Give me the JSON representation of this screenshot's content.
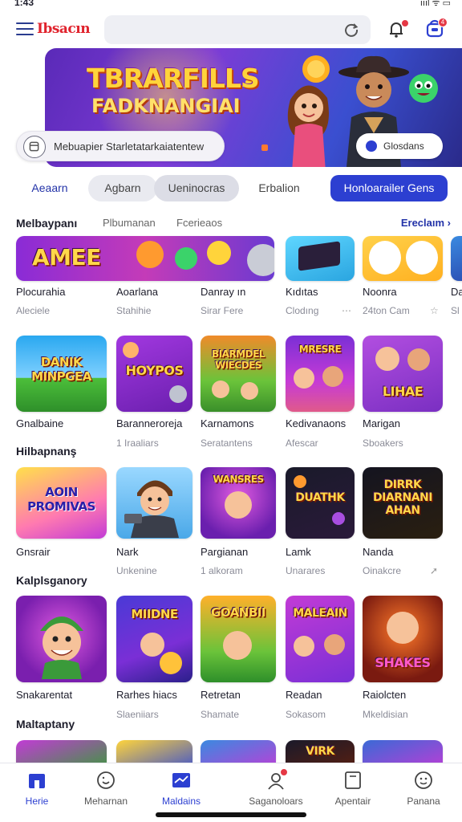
{
  "status": {
    "time": "1:43",
    "right": "ıııl ᯤ ▭"
  },
  "header": {
    "logo": "Ibsacın",
    "search_placeholder": "",
    "notif_badge": "",
    "cart_badge": "4"
  },
  "banner": {
    "title_line1": "TBRARFILLS",
    "title_line2": "FADKNANGIAI",
    "input_text": "Mebuapier Starletatarkaiatentew",
    "button_label": "Glosdans"
  },
  "tabs": [
    "Aeaarn",
    "Agbarn",
    "Ueninocras",
    "Erbalion",
    "Honloarailer Gens"
  ],
  "section1": {
    "title": "Melbaypanı",
    "subtabs": [
      "Plbumanan",
      "Fcerieaos"
    ],
    "see_all": "Ereclaım ›"
  },
  "row1": [
    {
      "name": "Plocurahia",
      "sub": "Aleciele",
      "art": "AMEE"
    },
    {
      "name": "Aoarlana",
      "sub": "Stahihie",
      "art": ""
    },
    {
      "name": "Danray ın",
      "sub": "Sirar Fere",
      "art": ""
    },
    {
      "name": "Kıdıtas",
      "sub": "Clodıng",
      "art": ""
    },
    {
      "name": "Noonra",
      "sub": "24ton Cam",
      "art": ""
    },
    {
      "name": "Da",
      "sub": "Sl",
      "art": ""
    }
  ],
  "row2": [
    {
      "name": "Gnalbaine",
      "sub": "",
      "art": "DANIK MINPGEA"
    },
    {
      "name": "Baranneroreja",
      "sub": "1 Iraaliars",
      "art": "HOYPOS"
    },
    {
      "name": "Karnamons",
      "sub": "Seratantens",
      "art": "BIARMDEL WIECDES"
    },
    {
      "name": "Kedivanaons",
      "sub": "Afescar",
      "art": "MRESRE"
    },
    {
      "name": "Marigan",
      "sub": "Sboakers",
      "art": "LIHAE"
    }
  ],
  "section2": {
    "title": "Hilbapnanş"
  },
  "row3": [
    {
      "name": "Gnsrair",
      "sub": "",
      "art": "AOIN PROMIVAS"
    },
    {
      "name": "Nark",
      "sub": "Unkenine",
      "art": ""
    },
    {
      "name": "Pargianan",
      "sub": "1 alkoram",
      "art": "WANSRES"
    },
    {
      "name": "Lamk",
      "sub": "Unarares",
      "art": "DUATHK"
    },
    {
      "name": "Nanda",
      "sub": "Oinakcre",
      "art": "DIRRK DIARNANI AHAN"
    }
  ],
  "section3": {
    "title": "Kalplsganory"
  },
  "row4": [
    {
      "name": "Snakarentat",
      "sub": "",
      "art": ""
    },
    {
      "name": "Rarhes hiacs",
      "sub": "Slaeniiars",
      "art": "MIIDNE"
    },
    {
      "name": "Retretan",
      "sub": "Shamate",
      "art": "GOANBII"
    },
    {
      "name": "Readan",
      "sub": "Sokasom",
      "art": "MALEAIN"
    },
    {
      "name": "Raiolcten",
      "sub": "Mkeldisian",
      "art": "SHAKES"
    }
  ],
  "section4": {
    "title": "Maltaptany"
  },
  "row5": [
    "",
    "",
    "",
    "VIRK",
    ""
  ],
  "bottom_nav": [
    {
      "label": "Herie",
      "icon": "home-icon",
      "active": true
    },
    {
      "label": "Meharnan",
      "icon": "smile-icon",
      "active": false
    },
    {
      "label": "Maldains",
      "icon": "chart-icon",
      "active": true
    },
    {
      "label": "Saganoloars",
      "icon": "user-icon",
      "active": false
    },
    {
      "label": "Apentair",
      "icon": "card-icon",
      "active": false
    },
    {
      "label": "Panana",
      "icon": "face-icon",
      "active": false
    }
  ],
  "colors": {
    "primary": "#2c3fd1",
    "logo": "#e0232d",
    "badge": "#e53845"
  }
}
